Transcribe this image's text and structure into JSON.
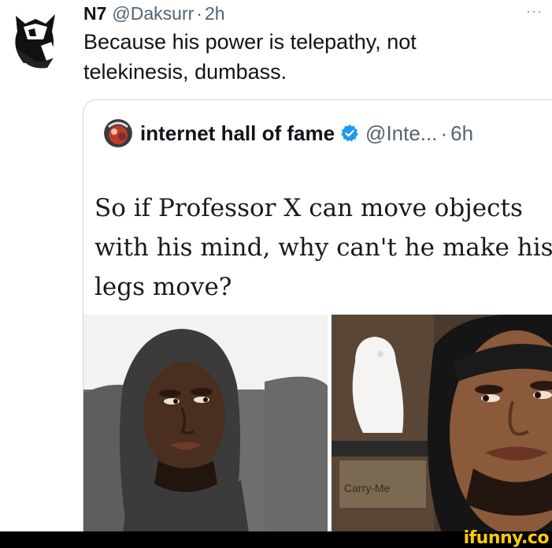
{
  "tweet": {
    "author_name": "N7",
    "author_handle": "@Daksurr",
    "separator": "·",
    "time": "2h",
    "more_icon": "···",
    "text": "Because his power is telepathy, not telekinesis, dumbass."
  },
  "quoted_tweet": {
    "author_name": "internet hall of fame",
    "verified_icon": "verified-badge-icon",
    "author_handle": "@Inte...",
    "separator": "·",
    "time": "6h",
    "meme_text": "So if Professor X can move objects with his mind, why can't he make his legs move?",
    "caption_board_text": "Carry-Me"
  },
  "watermark": {
    "text": "ifunny.co",
    "color": "#ffcc00"
  },
  "colors": {
    "text_primary": "#0f1419",
    "text_secondary": "#536471",
    "border": "#cfd9de",
    "verified_blue": "#1d9bf0"
  }
}
